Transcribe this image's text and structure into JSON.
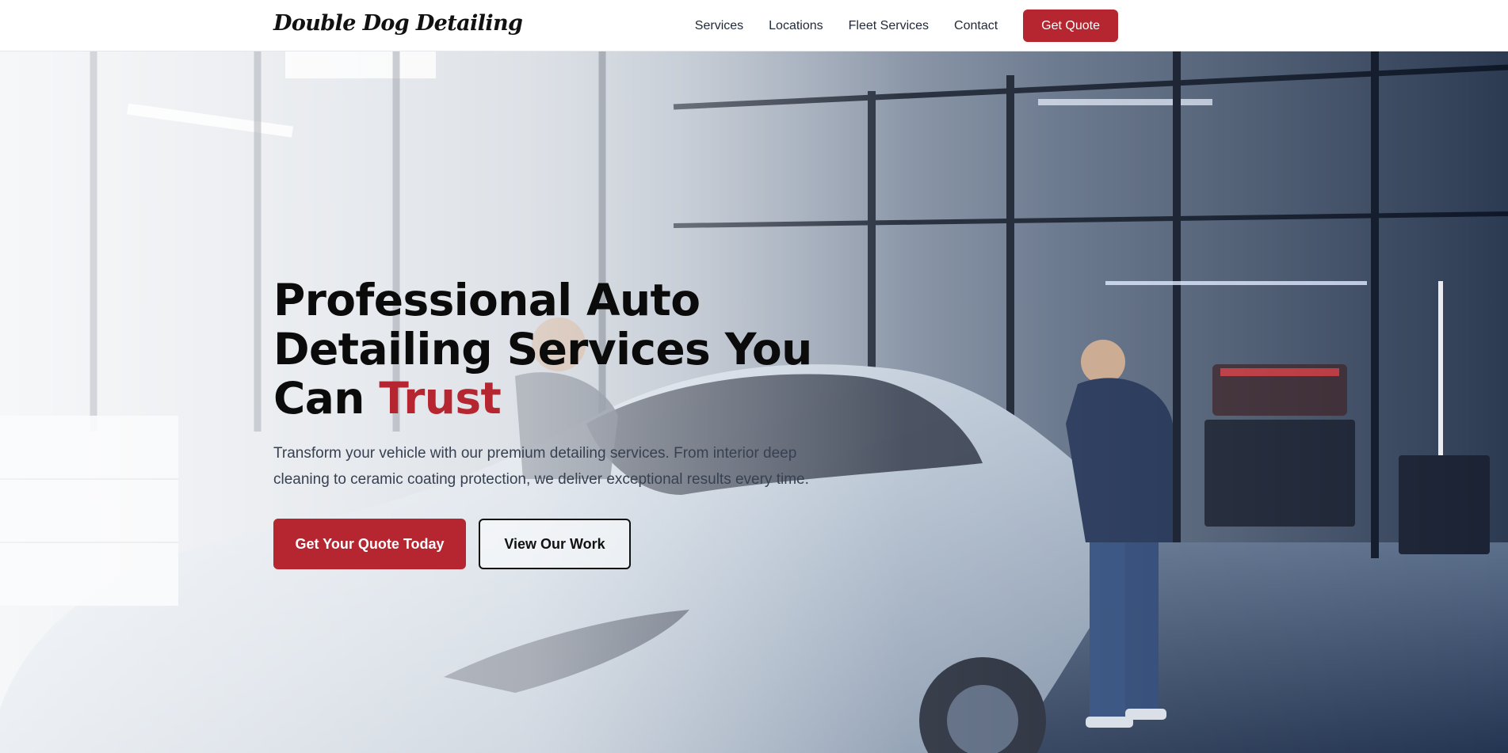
{
  "brand": {
    "name": "Double Dog Detailing"
  },
  "nav": {
    "links": [
      {
        "label": "Services"
      },
      {
        "label": "Locations"
      },
      {
        "label": "Fleet Services"
      },
      {
        "label": "Contact"
      }
    ],
    "cta_label": "Get Quote"
  },
  "hero": {
    "title_line1": "Professional Auto",
    "title_line2": "Detailing Services You",
    "title_line3_prefix": "Can ",
    "title_accent": "Trust",
    "subtitle": "Transform your vehicle with our premium detailing services. From interior deep cleaning to ceramic coating protection, we deliver exceptional results every time.",
    "primary_button": "Get Your Quote Today",
    "secondary_button": "View Our Work",
    "background": "photo-of-detailers-polishing-sports-car-in-garage"
  },
  "colors": {
    "accent": "#b52630",
    "text": "#0b0b0b",
    "nav_bg": "#ffffff"
  }
}
